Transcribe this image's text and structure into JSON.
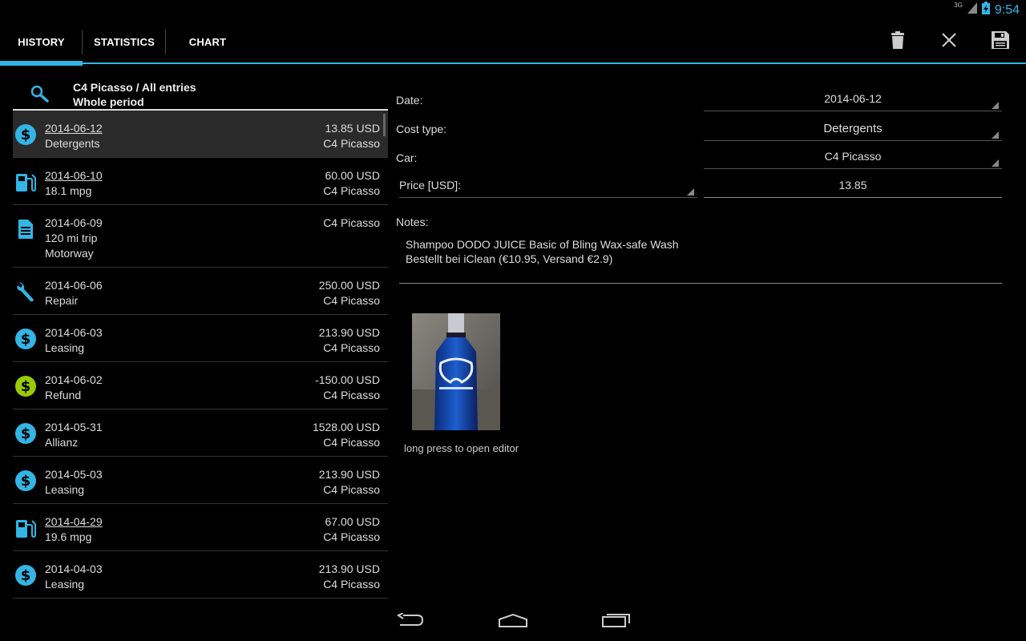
{
  "status": {
    "network": "3G",
    "clock": "9:54"
  },
  "tabs": [
    {
      "label": "HISTORY",
      "active": true
    },
    {
      "label": "STATISTICS",
      "active": false
    },
    {
      "label": "CHART",
      "active": false
    }
  ],
  "actions": {
    "delete": "trash-icon",
    "close": "close-icon",
    "save": "save-icon"
  },
  "filter": {
    "title": "C4 Picasso / All entries",
    "period": "Whole period"
  },
  "entries": [
    {
      "icon": "dollar-icon",
      "color": "#33b5e5",
      "date": "2014-06-12",
      "underline": true,
      "sub": "Detergents",
      "sub2": "",
      "amount": "13.85 USD",
      "car": "C4 Picasso"
    },
    {
      "icon": "fuel-icon",
      "color": "#33b5e5",
      "date": "2014-06-10",
      "underline": true,
      "sub": "18.1 mpg",
      "sub2": "",
      "amount": "60.00 USD",
      "car": "C4 Picasso"
    },
    {
      "icon": "document-icon",
      "color": "#33b5e5",
      "date": "2014-06-09",
      "underline": false,
      "sub": "120 mi trip",
      "sub2": "Motorway",
      "amount": "",
      "car": "C4 Picasso"
    },
    {
      "icon": "wrench-icon",
      "color": "#33b5e5",
      "date": "2014-06-06",
      "underline": false,
      "sub": "Repair",
      "sub2": "",
      "amount": "250.00 USD",
      "car": "C4 Picasso"
    },
    {
      "icon": "dollar-icon",
      "color": "#33b5e5",
      "date": "2014-06-03",
      "underline": false,
      "sub": "Leasing",
      "sub2": "",
      "amount": "213.90 USD",
      "car": "C4 Picasso"
    },
    {
      "icon": "dollar-icon",
      "color": "#99cc00",
      "date": "2014-06-02",
      "underline": false,
      "sub": "Refund",
      "sub2": "",
      "amount": "-150.00 USD",
      "car": "C4 Picasso"
    },
    {
      "icon": "dollar-icon",
      "color": "#33b5e5",
      "date": "2014-05-31",
      "underline": false,
      "sub": "Allianz",
      "sub2": "",
      "amount": "1528.00 USD",
      "car": "C4 Picasso"
    },
    {
      "icon": "dollar-icon",
      "color": "#33b5e5",
      "date": "2014-05-03",
      "underline": false,
      "sub": "Leasing",
      "sub2": "",
      "amount": "213.90 USD",
      "car": "C4 Picasso"
    },
    {
      "icon": "fuel-icon",
      "color": "#33b5e5",
      "date": "2014-04-29",
      "underline": true,
      "sub": "19.6 mpg",
      "sub2": "",
      "amount": "67.00 USD",
      "car": "C4 Picasso"
    },
    {
      "icon": "dollar-icon",
      "color": "#33b5e5",
      "date": "2014-04-03",
      "underline": false,
      "sub": "Leasing",
      "sub2": "",
      "amount": "213.90 USD",
      "car": "C4 Picasso"
    }
  ],
  "detail": {
    "date_label": "Date:",
    "date_value": "2014-06-12",
    "cost_type_label": "Cost type:",
    "cost_type_value": "Detergents",
    "car_label": "Car:",
    "car_value": "C4 Picasso",
    "price_label": "Price [USD]:",
    "price_value": "13.85",
    "notes_label": "Notes:",
    "notes_line1": "Shampoo DODO JUICE Basic of Bling Wax-safe Wash",
    "notes_line2": "Bestellt bei iClean (€10.95, Versand €2.9)",
    "photo_hint": "long press to open editor"
  },
  "accent": "#33b5e5"
}
